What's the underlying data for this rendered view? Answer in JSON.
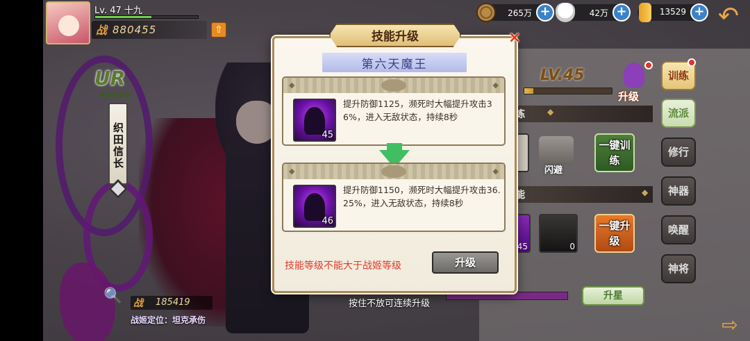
{
  "player": {
    "level_label": "Lv. 47 十九",
    "power_icon": "战",
    "power": "880455",
    "exp_fraction": 0.55
  },
  "resources": [
    {
      "icon": "coin-icon",
      "value": "265万"
    },
    {
      "icon": "rice-ball-icon",
      "value": "42万"
    },
    {
      "icon": "gold-bar-icon",
      "value": "13529"
    }
  ],
  "hero": {
    "rarity": "UR",
    "name": "织田信长",
    "power_icon": "战",
    "power": "185419",
    "role": "战姬定位：坦克承伤"
  },
  "right_panel": {
    "level": "LV.45",
    "level_fraction": 0.1,
    "upgrade_label": "升级",
    "section1": "练",
    "dodge_label": "闪避",
    "one_key_train": "一键训练",
    "section2": "能",
    "slot_level_a": "45",
    "slot_level_b": "0",
    "one_key_upgrade": "一键升级",
    "star_button": "升星"
  },
  "side_menu": [
    {
      "label": "训练",
      "state": "active"
    },
    {
      "label": "流派",
      "state": "green"
    },
    {
      "label": "修行",
      "state": "normal"
    },
    {
      "label": "神器",
      "state": "normal"
    },
    {
      "label": "唤醒",
      "state": "normal"
    },
    {
      "label": "神将",
      "state": "normal"
    }
  ],
  "dialog": {
    "title": "技能升级",
    "close": "×",
    "skill_name": "第六天魔王",
    "current": {
      "level": "45",
      "desc": "提升防御1125，濒死时大幅提升攻击36%，进入无敌状态，持续8秒"
    },
    "next": {
      "level": "46",
      "desc": "提升防御1150，濒死时大幅提升攻击36.25%，进入无敌状态，持续8秒"
    },
    "warning": "技能等级不能大于战姬等级",
    "upgrade_button": "升级",
    "hint": "按住不放可连续升级"
  },
  "colors": {
    "accent_gold": "#e0bf78",
    "warning_red": "#e23a2a",
    "skill_purple": "#6a12a8",
    "arrow_green": "#3fbf62"
  }
}
